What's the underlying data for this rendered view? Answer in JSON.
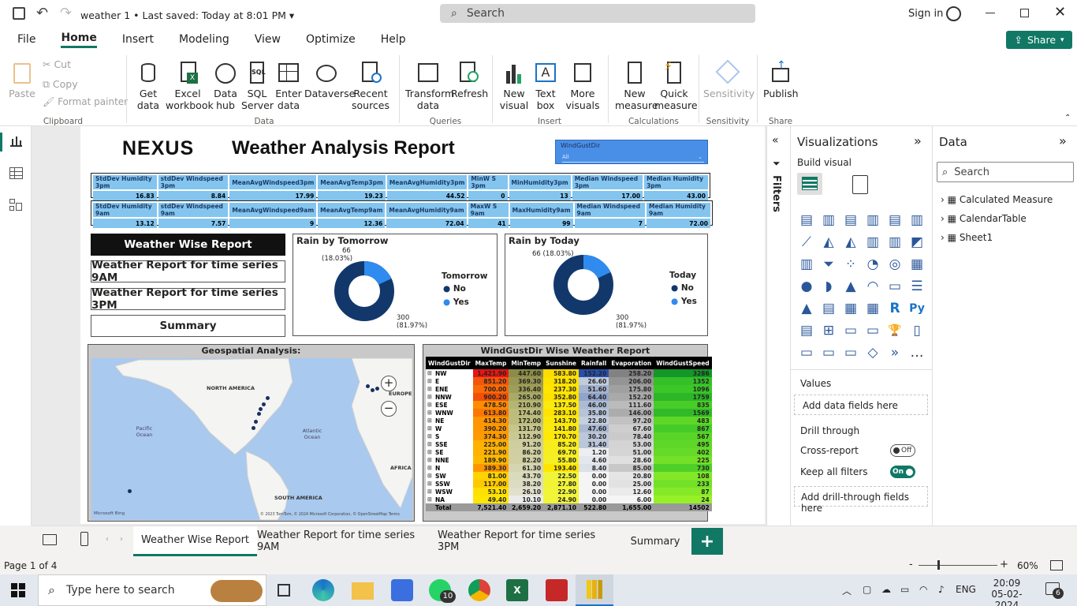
{
  "titlebar": {
    "file_title": "weather 1",
    "saved_status": "Last saved: Today at 8:01 PM",
    "search_placeholder": "Search",
    "sign_in": "Sign in"
  },
  "ribbon": {
    "tabs": [
      "File",
      "Home",
      "Insert",
      "Modeling",
      "View",
      "Optimize",
      "Help"
    ],
    "active_tab": "Home",
    "share_label": "Share",
    "clipboard": {
      "paste": "Paste",
      "cut": "Cut",
      "copy": "Copy",
      "format_painter": "Format painter",
      "group": "Clipboard"
    },
    "data_group": {
      "get_data": "Get data",
      "excel": "Excel workbook",
      "data_hub": "Data hub",
      "sql": "SQL Server",
      "enter_data": "Enter data",
      "dataverse": "Dataverse",
      "recent": "Recent sources",
      "group": "Data"
    },
    "queries": {
      "transform": "Transform data",
      "refresh": "Refresh",
      "group": "Queries"
    },
    "insert": {
      "new_visual": "New visual",
      "text_box": "Text box",
      "more_visuals": "More visuals",
      "group": "Insert"
    },
    "calculations": {
      "new_measure": "New measure",
      "quick_measure": "Quick measure",
      "group": "Calculations"
    },
    "sensitivity": {
      "label": "Sensitivity",
      "group": "Sensitivity"
    },
    "share": {
      "publish": "Publish",
      "group": "Share"
    }
  },
  "report": {
    "logo": "NEXUS",
    "title": "Weather Analysis Report",
    "slicer": {
      "label": "WindGustDir",
      "value": "All"
    },
    "kpi_3pm": {
      "headers": [
        "StdDev Humidity 3pm",
        "stdDev Windspeed 3pm",
        "MeanAvgWindspeed3pm",
        "MeanAvgTemp3pm",
        "MeanAvgHumidity3pm",
        "MinW S 3pm",
        "MinHumidity3pm",
        "Median Windspeed 3pm",
        "Median Humidity 3pm"
      ],
      "values": [
        "16.83",
        "8.84",
        "17.99",
        "19.23",
        "44.52",
        "0",
        "13",
        "17.00",
        "43.00"
      ]
    },
    "kpi_9am": {
      "headers": [
        "StdDev Humidity 9am",
        "stdDev Windspeed 9am",
        "MeanAvgWindspeed9am",
        "MeanAvgTemp9am",
        "MeanAvgHumidity9am",
        "MaxW S 9am",
        "MaxHumidity9am",
        "Median Windspeed 9am",
        "Median Humidity 9am"
      ],
      "values": [
        "13.12",
        "7.57",
        "9",
        "12.36",
        "72.04",
        "41",
        "99",
        "7",
        "72.00"
      ]
    },
    "nav_buttons": [
      "Weather Wise Report",
      "Weather Report for time series 9AM",
      "Weather Report for time series 3PM",
      "Summary"
    ],
    "donut_tomorrow": {
      "title": "Rain by Tomorrow",
      "legend_title": "Tomorrow",
      "legend": [
        "No",
        "Yes"
      ],
      "yes_label": "66",
      "yes_pct": "(18.03%)",
      "no_label": "300",
      "no_pct": "(81.97%)"
    },
    "donut_today": {
      "title": "Rain by Today",
      "legend_title": "Today",
      "legend": [
        "No",
        "Yes"
      ],
      "yes_label": "66 (18.03%)",
      "no_label": "300",
      "no_pct": "(81.97%)"
    },
    "map": {
      "title": "Geospatial Analysis:",
      "labels": [
        "NORTH AMERICA",
        "EUROPE",
        "Pacific Ocean",
        "Atlantic Ocean",
        "AFRICA",
        "SOUTH AMERICA"
      ],
      "credit": "Microsoft Bing",
      "copyright": "© 2023 TomTom, © 2024 Microsoft Corporation, © OpenStreetMap  Terms"
    },
    "wind_table": {
      "title": "WindGustDir Wise Weather Report",
      "columns": [
        "WindGustDir",
        "MaxTemp",
        "MinTemp",
        "Sunshine",
        "Rainfall",
        "Evaporation",
        "WindGustSpeed"
      ],
      "rows": [
        [
          "NW",
          "1,421.90",
          "447.60",
          "583.80",
          "152.20",
          "258.20",
          "3286"
        ],
        [
          "E",
          "851.20",
          "369.30",
          "318.20",
          "26.60",
          "206.00",
          "1352"
        ],
        [
          "ENE",
          "700.00",
          "336.40",
          "237.30",
          "51.60",
          "175.80",
          "1096"
        ],
        [
          "NNW",
          "900.20",
          "265.00",
          "352.80",
          "64.40",
          "152.20",
          "1759"
        ],
        [
          "ESE",
          "478.50",
          "210.90",
          "137.50",
          "46.00",
          "111.60",
          "835"
        ],
        [
          "WNW",
          "613.80",
          "174.40",
          "283.10",
          "35.80",
          "146.00",
          "1569"
        ],
        [
          "NE",
          "414.30",
          "172.00",
          "143.70",
          "22.80",
          "97.20",
          "483"
        ],
        [
          "W",
          "390.20",
          "131.70",
          "141.80",
          "47.60",
          "67.60",
          "867"
        ],
        [
          "S",
          "374.30",
          "112.90",
          "170.70",
          "30.20",
          "78.40",
          "567"
        ],
        [
          "SSE",
          "225.00",
          "91.20",
          "85.20",
          "31.40",
          "53.00",
          "495"
        ],
        [
          "SE",
          "221.90",
          "86.20",
          "69.70",
          "1.20",
          "51.00",
          "402"
        ],
        [
          "NNE",
          "189.90",
          "82.20",
          "55.80",
          "4.60",
          "28.60",
          "225"
        ],
        [
          "N",
          "389.30",
          "61.30",
          "193.40",
          "8.40",
          "85.00",
          "730"
        ],
        [
          "SW",
          "81.00",
          "43.70",
          "22.50",
          "0.00",
          "20.80",
          "108"
        ],
        [
          "SSW",
          "117.00",
          "38.20",
          "27.80",
          "0.00",
          "25.00",
          "233"
        ],
        [
          "WSW",
          "53.10",
          "26.10",
          "22.90",
          "0.00",
          "12.60",
          "87"
        ],
        [
          "NA",
          "49.40",
          "10.10",
          "24.90",
          "0.00",
          "6.00",
          "24"
        ]
      ],
      "total": [
        "Total",
        "7,521.40",
        "2,659.20",
        "2,871.10",
        "522.80",
        "1,655.00",
        "14502"
      ]
    }
  },
  "filters_pane": {
    "label": "Filters"
  },
  "viz_pane": {
    "title": "Visualizations",
    "build_visual": "Build visual",
    "values_label": "Values",
    "values_placeholder": "Add data fields here",
    "drill_through": "Drill through",
    "cross_report": "Cross-report",
    "cross_report_state": "Off",
    "keep_filters": "Keep all filters",
    "keep_filters_state": "On",
    "drill_placeholder": "Add drill-through fields here",
    "more": "..."
  },
  "data_pane": {
    "title": "Data",
    "search_placeholder": "Search",
    "tables": [
      "Calculated Measure",
      "CalendarTable",
      "Sheet1"
    ]
  },
  "page_tabs": [
    "Weather Wise Report",
    "Weather Report for time series 9AM",
    "Weather Report for time series 3PM",
    "Summary"
  ],
  "add_page": "+",
  "status": {
    "page": "Page 1 of 4",
    "zoom": "60%",
    "zoom_minus": "-",
    "zoom_plus": "+"
  },
  "taskbar": {
    "search_placeholder": "Type here to search",
    "whatsapp_badge": "10",
    "lang": "ENG",
    "time": "20:09",
    "date": "05-02-2024",
    "notif": "6"
  },
  "colors": {
    "accent": "#117865",
    "donut_no": "#12386b",
    "donut_yes": "#2f8bef",
    "kpi": "#83c5ef"
  }
}
